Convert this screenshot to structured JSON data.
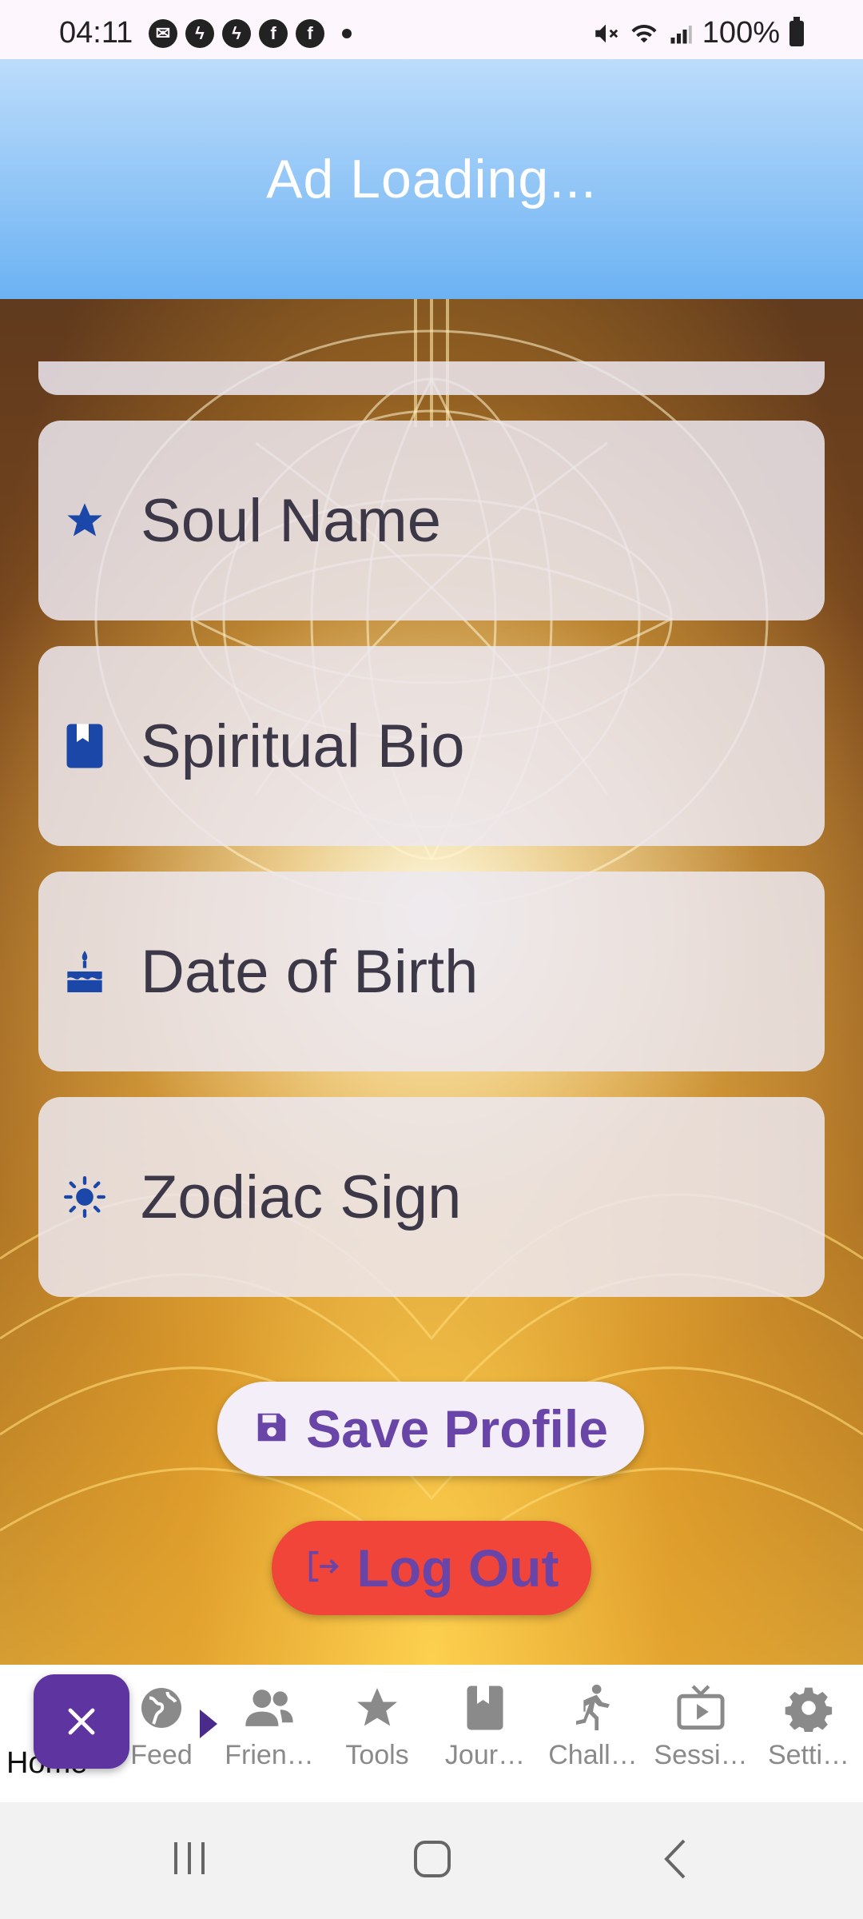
{
  "status_bar": {
    "time": "04:11",
    "battery": "100%"
  },
  "ad_banner": {
    "text": "Ad Loading..."
  },
  "profile_fields": [
    {
      "label": "Soul Name",
      "icon": "star-icon"
    },
    {
      "label": "Spiritual Bio",
      "icon": "book-icon"
    },
    {
      "label": "Date of Birth",
      "icon": "cake-icon"
    },
    {
      "label": "Zodiac Sign",
      "icon": "sun-icon"
    }
  ],
  "buttons": {
    "save_label": "Save Profile",
    "logout_label": "Log Out"
  },
  "bottom_nav": {
    "items": [
      {
        "label": "Home",
        "icon": "home-icon"
      },
      {
        "label": "Feed",
        "icon": "globe-icon"
      },
      {
        "label": "Frien…",
        "icon": "people-icon"
      },
      {
        "label": "Tools",
        "icon": "star-icon"
      },
      {
        "label": "Jour…",
        "icon": "book-icon"
      },
      {
        "label": "Chall…",
        "icon": "running-icon"
      },
      {
        "label": "Sessi…",
        "icon": "tv-icon"
      },
      {
        "label": "Setti…",
        "icon": "gear-icon"
      }
    ]
  },
  "colors": {
    "accent": "#5e35a0",
    "icon_blue": "#1a47a8",
    "logout_red": "#f2453a",
    "button_text": "#6a45a8"
  }
}
